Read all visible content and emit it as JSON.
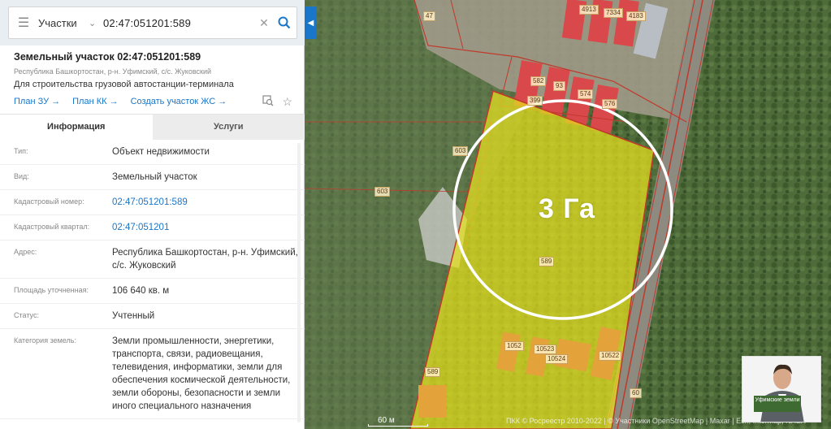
{
  "search": {
    "category": "Участки",
    "query": "02:47:051201:589"
  },
  "object": {
    "title": "Земельный участок 02:47:051201:589",
    "subtitle": "Республика Башкортостан, р-н. Уфимский, с/с. Жуковский",
    "purpose": "Для строительства грузовой автостанции-терминала",
    "links": [
      "План ЗУ →",
      "План КК →",
      "Создать участок ЖС →"
    ]
  },
  "tabs": [
    "Информация",
    "Услуги"
  ],
  "info": [
    {
      "label": "Тип:",
      "value": "Объект недвижимости"
    },
    {
      "label": "Вид:",
      "value": "Земельный участок"
    },
    {
      "label": "Кадастровый номер:",
      "value": "02:47:051201:589"
    },
    {
      "label": "Кадастровый квартал:",
      "value": "02:47:051201"
    },
    {
      "label": "Адрес:",
      "value": "Республика Башкортостан, р-н. Уфимский, с/с. Жуковский"
    },
    {
      "label": "Площадь уточненная:",
      "value": "106 640 кв. м"
    },
    {
      "label": "Статус:",
      "value": "Учтенный"
    },
    {
      "label": "Категория земель:",
      "value": "Земли промышленности, энергетики, транспорта, связи, радиовещания, телевидения, информатики, земли для обеспечения космической деятельности, земли обороны, безопасности и земли иного специального назначения"
    }
  ],
  "map": {
    "area_annotation": "3 Га",
    "plot_labels": [
      "589",
      "603",
      "603",
      "399",
      "582",
      "93",
      "574",
      "576",
      "4913",
      "7334",
      "4183",
      "47",
      "60",
      "1052",
      "10524",
      "10523",
      "10522",
      "589"
    ],
    "scale": "60 м",
    "attribution": "ПКК © Росреестр 2010-2022 | © Участники OpenStreetMap | Maxar | Esri, Intermap, NASA",
    "badge_text": "Уфимские земли",
    "colors": {
      "highlight": "#e8e21f",
      "border": "#c0392b",
      "accent": "#1a76c8"
    }
  }
}
